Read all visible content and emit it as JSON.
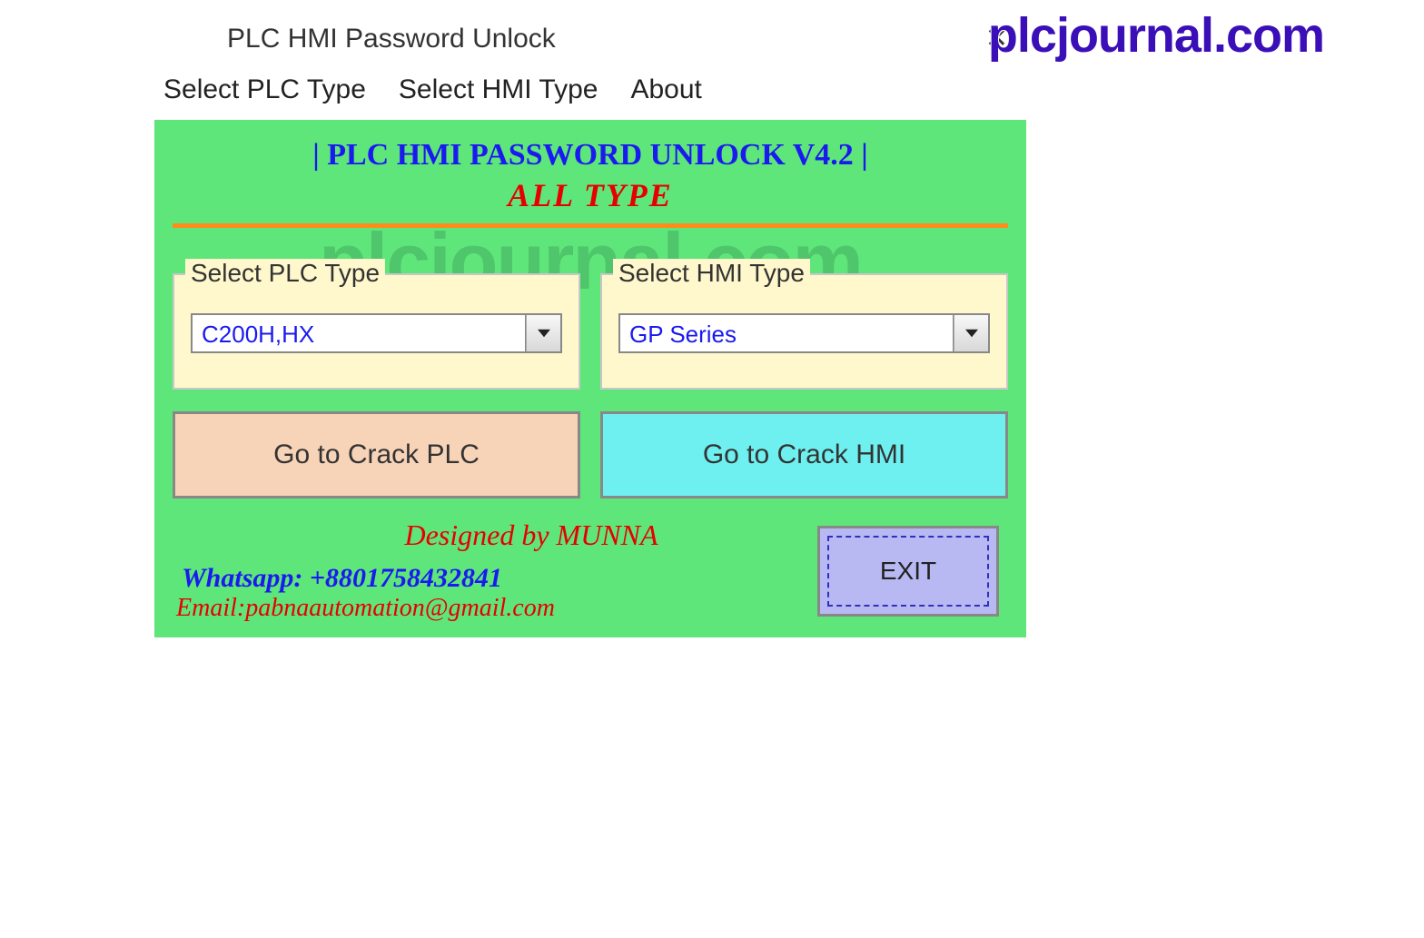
{
  "window": {
    "title": "PLC HMI Password Unlock"
  },
  "menu": {
    "plc": "Select PLC Type",
    "hmi": "Select HMI Type",
    "about": "About"
  },
  "heading": {
    "line1": "| PLC HMI PASSWORD UNLOCK V4.2 |",
    "line2": "ALL  TYPE"
  },
  "watermark": "plcjournal.com",
  "group_plc": {
    "legend": "Select PLC Type",
    "value": "C200H,HX"
  },
  "group_hmi": {
    "legend": "Select HMI Type",
    "value": "GP Series"
  },
  "buttons": {
    "crack_plc": "Go to Crack PLC",
    "crack_hmi": "Go to Crack HMI",
    "exit": "EXIT"
  },
  "credits": {
    "designed": "Designed by MUNNA",
    "whatsapp": "Whatsapp: +8801758432841",
    "email": "Email:pabnaautomation@gmail.com"
  },
  "overlay_brand": "plcjournal.com"
}
